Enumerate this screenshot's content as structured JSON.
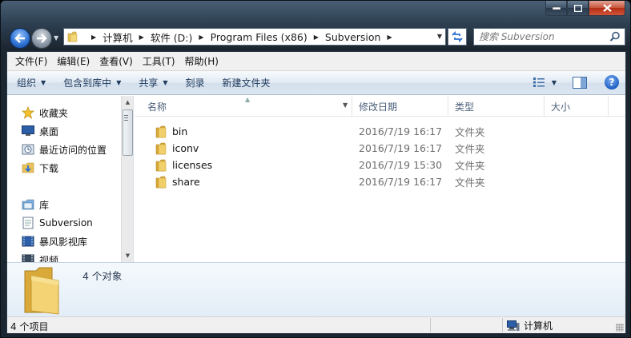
{
  "window": {
    "controls": [
      "minimize",
      "maximize",
      "close"
    ]
  },
  "address": {
    "crumbs": [
      "计算机",
      "软件 (D:)",
      "Program Files (x86)",
      "Subversion"
    ]
  },
  "search": {
    "placeholder": "搜索 Subversion"
  },
  "menu": {
    "file": "文件(F)",
    "edit": "编辑(E)",
    "view": "查看(V)",
    "tools": "工具(T)",
    "help": "帮助(H)"
  },
  "toolbar": {
    "organize": "组织",
    "include_in_library": "包含到库中",
    "share": "共享",
    "burn": "刻录",
    "new_folder": "新建文件夹"
  },
  "navpane": {
    "favorites": "收藏夹",
    "desktop": "桌面",
    "recent": "最近访问的位置",
    "downloads": "下载",
    "libraries": "库",
    "subversion": "Subversion",
    "baofeng": "暴风影视库",
    "videos": "视频"
  },
  "columns": {
    "name": "名称",
    "date": "修改日期",
    "type": "类型",
    "size": "大小"
  },
  "files": [
    {
      "name": "bin",
      "date": "2016/7/19 16:17",
      "type": "文件夹"
    },
    {
      "name": "iconv",
      "date": "2016/7/19 16:17",
      "type": "文件夹"
    },
    {
      "name": "licenses",
      "date": "2016/7/19 15:30",
      "type": "文件夹"
    },
    {
      "name": "share",
      "date": "2016/7/19 16:17",
      "type": "文件夹"
    }
  ],
  "details": {
    "count": "4 个对象"
  },
  "status": {
    "items": "4 个项目",
    "location": "计算机"
  },
  "colors": {
    "folder": "#e8c25a",
    "toolbar_text": "#1e395b",
    "header_text": "#4c607a"
  }
}
